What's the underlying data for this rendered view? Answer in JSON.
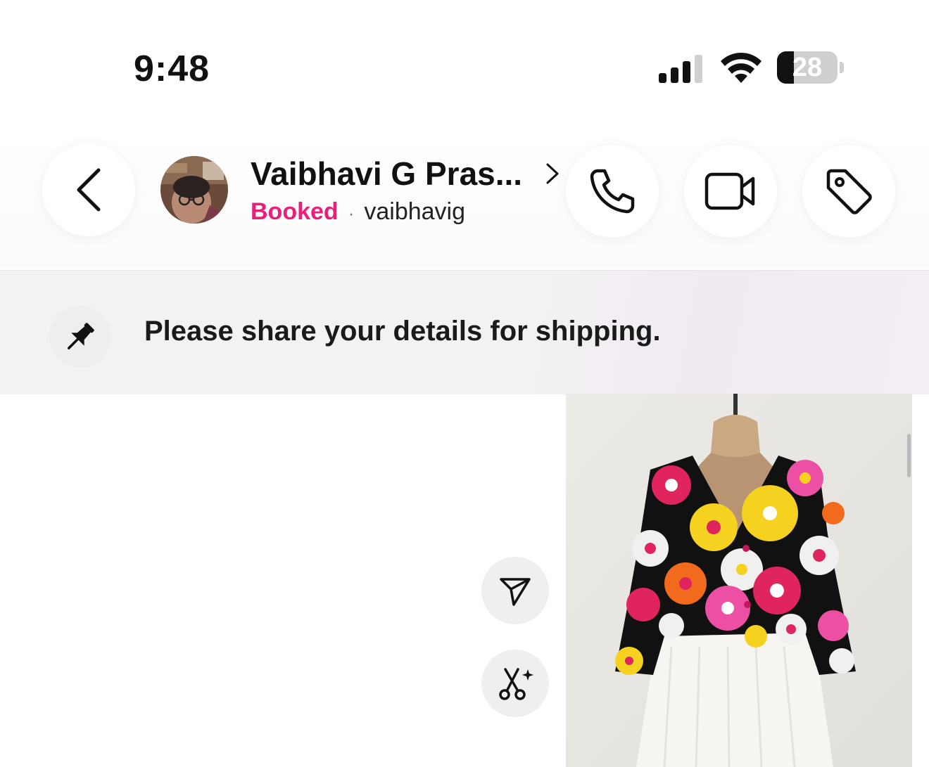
{
  "status_bar": {
    "time": "9:48",
    "battery_level": "28",
    "battery_fraction": 0.28,
    "signal_bars": 3
  },
  "header": {
    "contact_name": "Vaibhavi G Pras...",
    "status_label": "Booked",
    "separator": "·",
    "username": "vaibhavig",
    "status_color": "#e8207a",
    "icons": [
      "back-icon",
      "chevron-right-icon",
      "phone-icon",
      "video-camera-icon",
      "tag-icon"
    ]
  },
  "pinned": {
    "icon": "pin-icon",
    "message": "Please share your details for shipping."
  },
  "message": {
    "actions": [
      "forward-icon",
      "scissors-sparkle-icon"
    ],
    "image_subject": "floral embroidered black blazer on dress form"
  }
}
